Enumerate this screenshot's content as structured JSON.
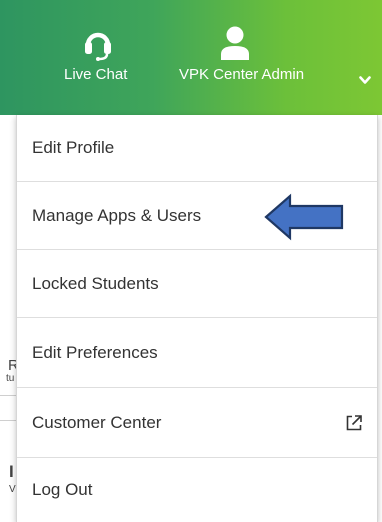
{
  "header": {
    "live_chat_label": "Live Chat",
    "admin_label": "VPK Center Admin",
    "icons": [
      "headset-icon",
      "user-icon",
      "chevron-down-icon"
    ],
    "gradient": [
      "#2e9560",
      "#7dc734"
    ]
  },
  "background": {
    "fragments": [
      "R",
      "tu",
      "I",
      "V"
    ]
  },
  "menu": {
    "items": [
      {
        "label": "Edit Profile"
      },
      {
        "label": "Manage Apps & Users"
      },
      {
        "label": "Locked Students"
      },
      {
        "label": "Edit Preferences"
      },
      {
        "label": "Customer Center",
        "icon": "external-link-icon"
      },
      {
        "label": "Log Out"
      }
    ]
  },
  "annotation": {
    "icon": "left-arrow-icon",
    "fill": "#4472c4",
    "stroke": "#1f3864"
  }
}
